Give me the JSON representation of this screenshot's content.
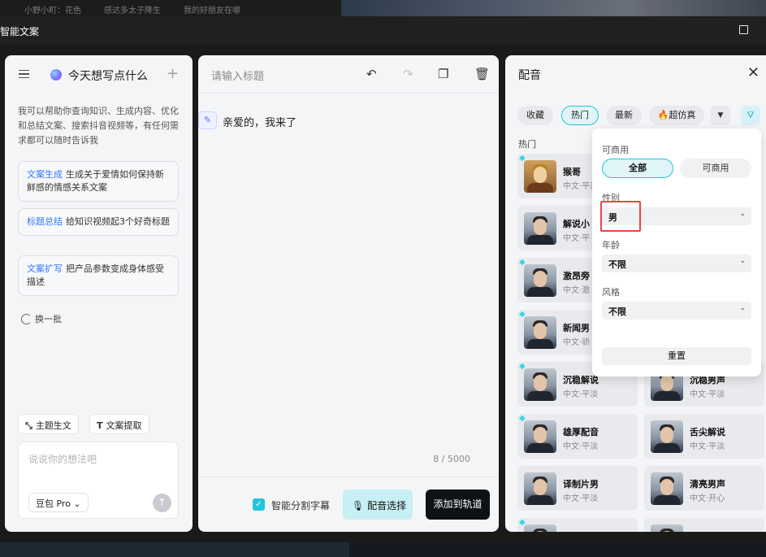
{
  "background": {
    "tabs": [
      "小野小町：花色",
      "感达多太子降生",
      "我的好朋友在哪"
    ]
  },
  "window": {
    "title": "智能文案"
  },
  "left": {
    "heading": "今天想写点什么",
    "intro": "我可以帮助你查询知识、生成内容、优化和总结文案、搜索抖音视频等，有任何需求都可以随时告诉我",
    "suggestions": [
      {
        "tag": "文案生成",
        "text": "生成关于爱情如何保持新鲜感的情感关系文案"
      },
      {
        "tag": "标题总结",
        "text": "给知识视频起3个好奇标题"
      },
      {
        "tag": "文案扩写",
        "text": "把产品参数变成身体感受描述"
      }
    ],
    "refresh_label": "换一批",
    "chips": [
      {
        "icon": "⤡",
        "label": "主题生文"
      },
      {
        "icon": "T",
        "label": "文案提取"
      }
    ],
    "input_placeholder": "说说你的想法吧",
    "model": "豆包 Pro"
  },
  "middle": {
    "title_placeholder": "请输入标题",
    "line_text": "亲爱的，我来了",
    "counter": "8 / 5000",
    "checkbox_label": "智能分割字幕",
    "checkbox_checked": true,
    "voice_button": "配音选择",
    "add_button": "添加到轨道"
  },
  "right": {
    "title": "配音",
    "tabs": [
      "收藏",
      "热门",
      "最新",
      "🔥超仿真"
    ],
    "active_tab": "热门",
    "section": "热门",
    "voices": [
      {
        "name": "猴哥",
        "sub": "中文·平淡"
      },
      {
        "name": "解说小",
        "sub": "中文·平"
      },
      {
        "name": "激昂旁",
        "sub": "中文·激"
      },
      {
        "name": "新闻男",
        "sub": "中文·骄"
      },
      {
        "name": "沉稳解说",
        "sub": "中文·平淡"
      },
      {
        "name": "沉稳男声",
        "sub": "中文·平淡"
      },
      {
        "name": "雄厚配音",
        "sub": "中文·平淡"
      },
      {
        "name": "舌尖解说",
        "sub": "中文·平淡"
      },
      {
        "name": "译制片男",
        "sub": "中文·平淡"
      },
      {
        "name": "清亮男声",
        "sub": "中文·开心"
      }
    ]
  },
  "filter": {
    "commercial_label": "可商用",
    "commercial_options": [
      "全部",
      "可商用"
    ],
    "gender_label": "性别",
    "gender_value": "男",
    "age_label": "年龄",
    "age_value": "不限",
    "style_label": "风格",
    "style_value": "不限",
    "reset_label": "重置"
  },
  "colors": {
    "accent": "#23c5d7",
    "highlight": "#e84545"
  }
}
